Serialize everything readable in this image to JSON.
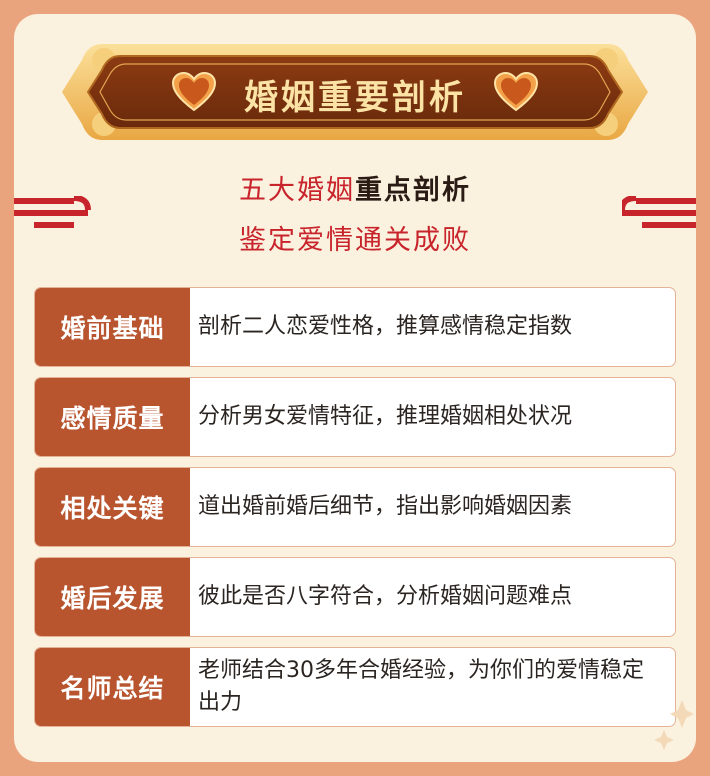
{
  "banner": {
    "title": "婚姻重要剖析"
  },
  "subtitle": {
    "line1_normal": "五大婚姻",
    "line1_bold": "重点剖析",
    "line2": "鉴定爱情通关成败"
  },
  "rows": [
    {
      "label": "婚前基础",
      "desc": "剖析二人恋爱性格，推算感情稳定指数"
    },
    {
      "label": "感情质量",
      "desc": "分析男女爱情特征，推理婚姻相处状况"
    },
    {
      "label": "相处关键",
      "desc": "道出婚前婚后细节，指出影响婚姻因素"
    },
    {
      "label": "婚后发展",
      "desc": "彼此是否八字符合，分析婚姻问题难点"
    },
    {
      "label": "名师总结",
      "desc": "老师结合30多年合婚经验，为你们的爱情稳定出力"
    }
  ],
  "colors": {
    "accent": "#b8552f",
    "red": "#c8242b",
    "banner": "#7a3210",
    "gold": "#f3c26a"
  }
}
